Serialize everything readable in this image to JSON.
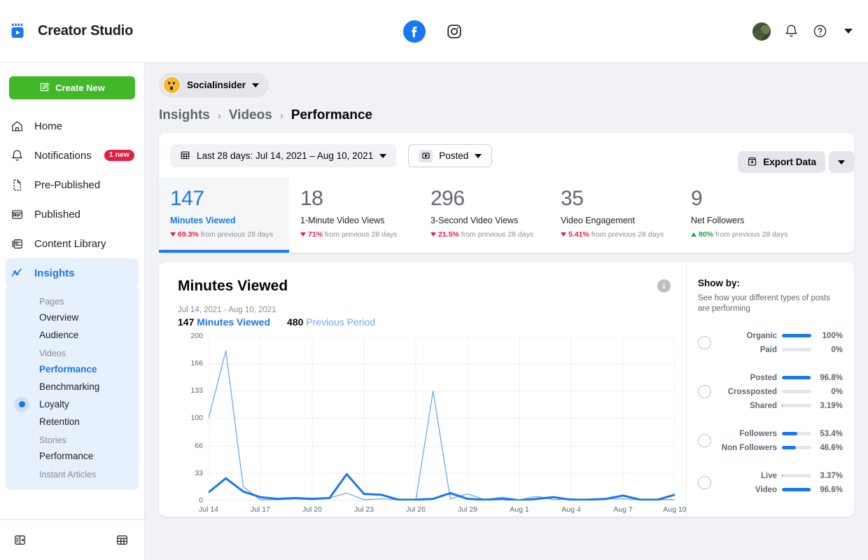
{
  "topbar": {
    "brand_title": "Creator Studio",
    "logo_icon": "creator-studio-logo",
    "facebook_icon": "facebook-icon",
    "instagram_icon": "instagram-icon",
    "avatar_icon": "user-avatar",
    "bell_icon": "bell-icon",
    "help_icon": "help-icon",
    "caret_icon": "chevron-down-icon"
  },
  "sidebar": {
    "create_label": "Create New",
    "create_icon": "compose-icon",
    "create_color": "#42b72a",
    "items": [
      {
        "label": "Home",
        "icon": "home-icon",
        "badge": ""
      },
      {
        "label": "Notifications",
        "icon": "bell-icon",
        "badge": "1 new"
      },
      {
        "label": "Pre-Published",
        "icon": "document-icon",
        "badge": ""
      },
      {
        "label": "Published",
        "icon": "published-card-icon",
        "badge": ""
      },
      {
        "label": "Content Library",
        "icon": "content-library-icon",
        "badge": ""
      },
      {
        "label": "Insights",
        "icon": "insights-chart-icon",
        "badge": ""
      }
    ],
    "subnav": [
      {
        "type": "group",
        "label": "Pages"
      },
      {
        "type": "item",
        "label": "Overview",
        "state": ""
      },
      {
        "type": "item",
        "label": "Audience",
        "state": ""
      },
      {
        "type": "group",
        "label": "Videos"
      },
      {
        "type": "item",
        "label": "Performance",
        "state": "current"
      },
      {
        "type": "item",
        "label": "Benchmarking",
        "state": ""
      },
      {
        "type": "item",
        "label": "Loyalty",
        "state": "dot"
      },
      {
        "type": "item",
        "label": "Retention",
        "state": ""
      },
      {
        "type": "group",
        "label": "Stories"
      },
      {
        "type": "item",
        "label": "Performance",
        "state": ""
      },
      {
        "type": "group",
        "label": "Instant Articles"
      }
    ],
    "footer_left_icon": "collapse-panel-icon",
    "footer_right_icon": "grid-table-icon"
  },
  "header": {
    "page_chip_name": "Socialinsider",
    "page_chip_caret": "chevron-down-icon",
    "breadcrumb": [
      "Insights",
      "Videos",
      "Performance"
    ],
    "export_label": "Export Data",
    "export_icon": "download-box-icon",
    "export_caret_icon": "chevron-down-icon"
  },
  "filters": {
    "date_range": "Last 28 days: Jul 14, 2021 – Aug 10, 2021",
    "date_icon": "calendar-icon",
    "post_type": "Posted",
    "post_icon": "video-play-icon",
    "caret_icon": "chevron-down-icon"
  },
  "metrics": [
    {
      "value": "147",
      "label": "Minutes Viewed",
      "delta": "69.3%",
      "suffix": "from previous 28 days",
      "direction": "down",
      "selected": true
    },
    {
      "value": "18",
      "label": "1-Minute Video Views",
      "delta": "71%",
      "suffix": "from previous 28 days",
      "direction": "down",
      "selected": false
    },
    {
      "value": "296",
      "label": "3-Second Video Views",
      "delta": "21.5%",
      "suffix": "from previous 28 days",
      "direction": "down",
      "selected": false
    },
    {
      "value": "35",
      "label": "Video Engagement",
      "delta": "5.41%",
      "suffix": "from previous 28 days",
      "direction": "down",
      "selected": false
    },
    {
      "value": "9",
      "label": "Net Followers",
      "delta": "80%",
      "suffix": "from previous 28 days",
      "direction": "up",
      "selected": false
    }
  ],
  "chart_panel": {
    "title": "Minutes Viewed",
    "range": "Jul 14, 2021 - Aug 10, 2021",
    "legend": [
      {
        "value": "147",
        "name": "Minutes Viewed",
        "color": "#1877f2"
      },
      {
        "value": "480",
        "name": "Previous Period",
        "color": "#6ea8f5"
      }
    ],
    "info_icon": "info-icon"
  },
  "chart_data": {
    "type": "line",
    "title": "Minutes Viewed",
    "xlabel": "",
    "ylabel": "",
    "ylim": [
      0,
      200
    ],
    "yticks": [
      0,
      33,
      66,
      100,
      133,
      166,
      200
    ],
    "grid": true,
    "legend_position": "top-left",
    "x": [
      "Jul 14",
      "Jul 15",
      "Jul 16",
      "Jul 17",
      "Jul 18",
      "Jul 19",
      "Jul 20",
      "Jul 21",
      "Jul 22",
      "Jul 23",
      "Jul 24",
      "Jul 25",
      "Jul 26",
      "Jul 27",
      "Jul 28",
      "Jul 29",
      "Jul 30",
      "Jul 31",
      "Aug 1",
      "Aug 2",
      "Aug 3",
      "Aug 4",
      "Aug 5",
      "Aug 6",
      "Aug 7",
      "Aug 8",
      "Aug 9",
      "Aug 10"
    ],
    "xticks": [
      "Jul 14",
      "Jul 17",
      "Jul 20",
      "Jul 23",
      "Jul 26",
      "Jul 29",
      "Aug 1",
      "Aug 4",
      "Aug 7",
      "Aug 10"
    ],
    "series": [
      {
        "name": "Minutes Viewed",
        "color": "#1877f2",
        "width": 3,
        "values": [
          10,
          27,
          11,
          4,
          2,
          3,
          2,
          3,
          32,
          8,
          7,
          1,
          1,
          2,
          9,
          2,
          1,
          2,
          0,
          2,
          4,
          1,
          1,
          2,
          6,
          1,
          1,
          7
        ]
      },
      {
        "name": "Previous Period",
        "color": "#6ea8f5",
        "width": 1.3,
        "values": [
          100,
          182,
          17,
          1,
          1,
          2,
          1,
          3,
          9,
          1,
          2,
          1,
          0,
          133,
          2,
          8,
          1,
          4,
          1,
          5,
          1,
          2,
          1,
          2,
          2,
          1,
          1,
          1
        ]
      }
    ]
  },
  "show_by": {
    "title": "Show by:",
    "description": "See how your different types of posts are performing",
    "groups": [
      {
        "radio_name": "radio-organic-paid",
        "rows": [
          {
            "label": "Organic",
            "pct": "100%",
            "fill": 100
          },
          {
            "label": "Paid",
            "pct": "0%",
            "fill": 0
          }
        ]
      },
      {
        "radio_name": "radio-posted-crossposted-shared",
        "rows": [
          {
            "label": "Posted",
            "pct": "96.8%",
            "fill": 96.8
          },
          {
            "label": "Crossposted",
            "pct": "0%",
            "fill": 0
          },
          {
            "label": "Shared",
            "pct": "3.19%",
            "fill": 3.19
          }
        ]
      },
      {
        "radio_name": "radio-followers",
        "rows": [
          {
            "label": "Followers",
            "pct": "53.4%",
            "fill": 53.4
          },
          {
            "label": "Non Followers",
            "pct": "46.6%",
            "fill": 46.6
          }
        ]
      },
      {
        "radio_name": "radio-live-video",
        "rows": [
          {
            "label": "Live",
            "pct": "3.37%",
            "fill": 3.37
          },
          {
            "label": "Video",
            "pct": "96.6%",
            "fill": 96.6
          }
        ]
      }
    ]
  }
}
